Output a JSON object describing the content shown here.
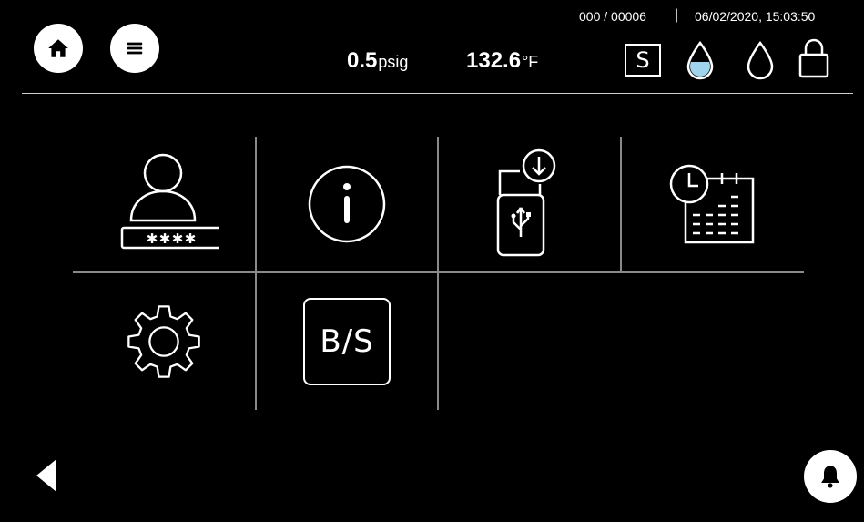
{
  "header": {
    "counter": "000 / 00006",
    "separator": "|",
    "datetime": "06/02/2020, 15:03:50",
    "pressure": {
      "value": "0.5",
      "unit": "psig"
    },
    "temperature": {
      "value": "132.6",
      "unit": "°F"
    },
    "mode_letter": "S",
    "icons": [
      "home-icon",
      "menu-icon",
      "water-drop-filled-icon",
      "water-drop-empty-icon",
      "lock-open-icon"
    ]
  },
  "menu": {
    "tiles": [
      {
        "name": "user-login",
        "icon": "user-password-icon"
      },
      {
        "name": "info",
        "icon": "info-icon"
      },
      {
        "name": "usb-download",
        "icon": "usb-download-icon"
      },
      {
        "name": "schedule",
        "icon": "calendar-clock-icon"
      },
      {
        "name": "settings",
        "icon": "gear-icon"
      },
      {
        "name": "bs",
        "label": "B/S"
      }
    ]
  },
  "footer": {
    "icons": [
      "back-arrow-icon",
      "bell-icon"
    ]
  },
  "colors": {
    "background": "#000000",
    "foreground": "#ffffff",
    "divider": "#8a8a8a"
  }
}
